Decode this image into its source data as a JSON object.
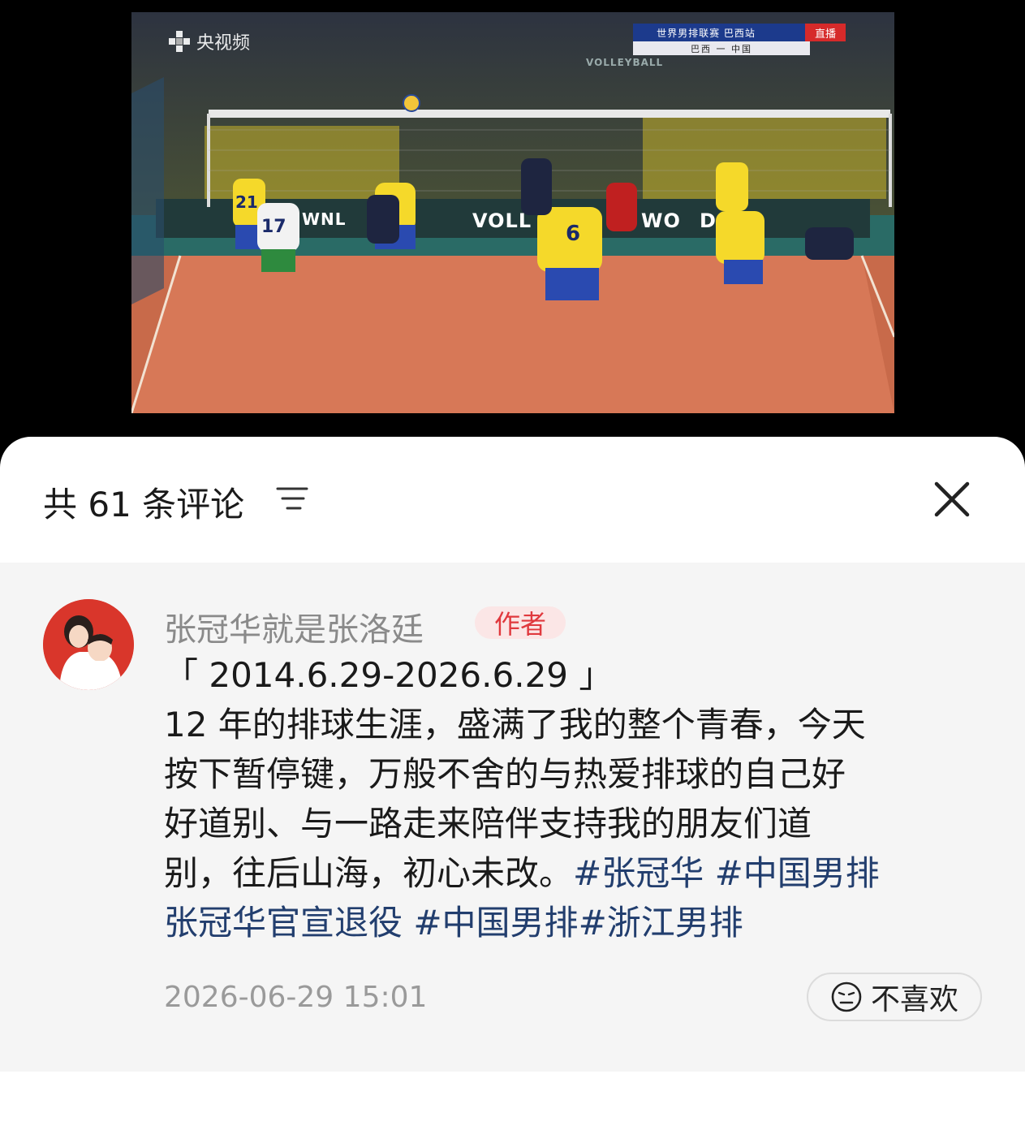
{
  "video": {
    "watermark": "央视频",
    "score_title": "世界男排联赛 巴西站",
    "live_label": "直播",
    "teams": "巴西 一 中国",
    "banner": [
      "VOLLEYBALL",
      "WNL",
      "VOLL",
      "WO",
      "D"
    ],
    "jerseys": [
      "21",
      "17",
      "6"
    ]
  },
  "header": {
    "title": "共 61 条评论",
    "sort_icon": "sort-icon",
    "close_icon": "close-icon"
  },
  "comment": {
    "username": "张冠华就是张洛廷",
    "badge": "作者",
    "lines": [
      "「 2014.6.29-2026.6.29 」",
      "12 年的排球生涯，盛满了我的整个青春，今天",
      "按下暂停键，万般不舍的与热爱排球的自己好",
      "好道别、与一路走来陪伴支持我的朋友们道",
      "别，往后山海，初心未改。"
    ],
    "tags_line4": [
      "#张冠华",
      " #中国男排"
    ],
    "tags_line5": [
      "张冠华官宣退役",
      " #中国男排",
      "#浙江男排"
    ],
    "timestamp": "2026-06-29 15:01",
    "dislike_label": "不喜欢"
  },
  "colors": {
    "accent_link": "#223e6e",
    "badge_text": "#e0393e",
    "badge_bg": "#fbe6e6"
  }
}
